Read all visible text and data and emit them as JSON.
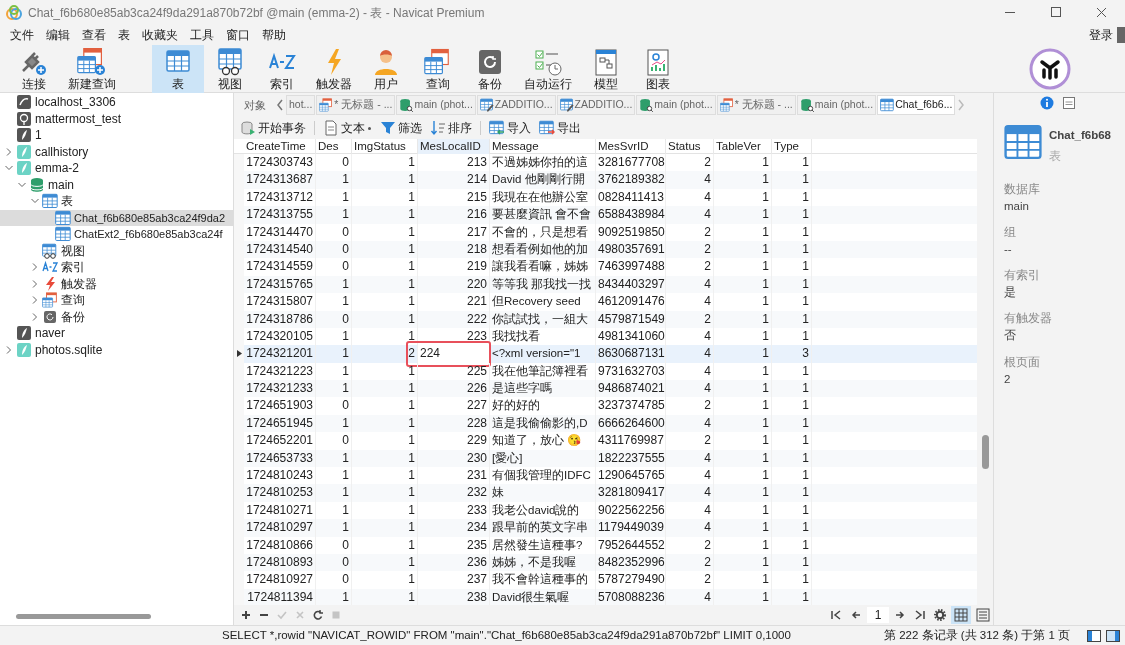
{
  "window": {
    "title": "Chat_f6b680e85ab3ca24f9da291a870b72bf @main (emma-2) - 表 - Navicat Premium"
  },
  "menu": [
    "文件",
    "编辑",
    "查看",
    "表",
    "收藏夹",
    "工具",
    "窗口",
    "帮助"
  ],
  "login": "登录",
  "toolbar": [
    {
      "label": "连接",
      "selected": false
    },
    {
      "label": "新建查询",
      "selected": false
    },
    {
      "label": "表",
      "selected": true
    },
    {
      "label": "视图",
      "selected": false
    },
    {
      "label": "索引",
      "selected": false
    },
    {
      "label": "触发器",
      "selected": false
    },
    {
      "label": "用户",
      "selected": false
    },
    {
      "label": "查询",
      "selected": false
    },
    {
      "label": "备份",
      "selected": false
    },
    {
      "label": "自动运行",
      "selected": false
    },
    {
      "label": "模型",
      "selected": false
    },
    {
      "label": "图表",
      "selected": false
    }
  ],
  "sidebar": {
    "tree": [
      {
        "kind": "mysql",
        "label": "localhost_3306",
        "selected": false
      },
      {
        "kind": "postgres",
        "label": "mattermost_test",
        "selected": false
      },
      {
        "kind": "sqlite-off",
        "label": "1",
        "selected": false
      },
      {
        "kind": "sqlite",
        "label": "callhistory",
        "expanded": false,
        "selected": false
      },
      {
        "kind": "sqlite",
        "label": "emma-2",
        "expanded": true,
        "selected": false,
        "children": [
          {
            "kind": "database",
            "label": "main",
            "expanded": true,
            "selected": false,
            "children": [
              {
                "kind": "tables",
                "label": "表",
                "expanded": true,
                "selected": false,
                "children": [
                  {
                    "kind": "table",
                    "label": "Chat_f6b680e85ab3ca24f9da2",
                    "selected": true
                  },
                  {
                    "kind": "table",
                    "label": "ChatExt2_f6b680e85ab3ca24f",
                    "selected": false
                  }
                ]
              },
              {
                "kind": "view",
                "label": "视图",
                "selected": false
              },
              {
                "kind": "index",
                "label": "索引",
                "expanded": false,
                "selected": false
              },
              {
                "kind": "trigger",
                "label": "触发器",
                "expanded": false,
                "selected": false
              },
              {
                "kind": "query",
                "label": "查询",
                "expanded": false,
                "selected": false
              },
              {
                "kind": "backup",
                "label": "备份",
                "expanded": false,
                "selected": false
              }
            ]
          }
        ]
      },
      {
        "kind": "sqlite-off",
        "label": "naver",
        "selected": false
      },
      {
        "kind": "sqlite",
        "label": "photos.sqlite",
        "expanded": false,
        "selected": false
      }
    ]
  },
  "tabs": {
    "objects_label": "对象",
    "items": [
      {
        "kind": "plain",
        "label": "hot...",
        "selected": false
      },
      {
        "kind": "query",
        "label": "* 无标题 - ...",
        "selected": false
      },
      {
        "kind": "database",
        "label": "main (phot...",
        "selected": false
      },
      {
        "kind": "design",
        "label": "ZADDITIO...",
        "selected": false
      },
      {
        "kind": "design",
        "label": "ZADDITIO...",
        "selected": false
      },
      {
        "kind": "database",
        "label": "main (phot...",
        "selected": false
      },
      {
        "kind": "query",
        "label": "* 无标题 - ...",
        "selected": false
      },
      {
        "kind": "database",
        "label": "main (phot...",
        "selected": false
      },
      {
        "kind": "table",
        "label": "Chat_f6b6...",
        "selected": true
      }
    ]
  },
  "actions": [
    "开始事务",
    "文本",
    "筛选",
    "排序",
    "导入",
    "导出"
  ],
  "table": {
    "columns": [
      "CreateTime",
      "Des",
      "ImgStatus",
      "MesLocalID",
      "Message",
      "MesSvrID",
      "Status",
      "TableVer",
      "Type"
    ],
    "rows": [
      {
        "cells": [
          "1724303743",
          "0",
          "1",
          "213",
          "不過姊姊你拍的這",
          "3281677708",
          "2",
          "1",
          "1"
        ],
        "current": false,
        "editing": false,
        "highlighted": false
      },
      {
        "cells": [
          "1724313687",
          "1",
          "1",
          "214",
          "David 他剛剛行開",
          "3762189382",
          "4",
          "1",
          "1"
        ],
        "current": false,
        "editing": false,
        "highlighted": false
      },
      {
        "cells": [
          "1724313712",
          "1",
          "1",
          "215",
          "我現在在他辦公室",
          "0828411413",
          "4",
          "1",
          "1"
        ],
        "current": false,
        "editing": false,
        "highlighted": false
      },
      {
        "cells": [
          "1724313755",
          "1",
          "1",
          "216",
          "要甚麼資訊 會不會",
          "6588438984",
          "4",
          "1",
          "1"
        ],
        "current": false,
        "editing": false,
        "highlighted": false
      },
      {
        "cells": [
          "1724314470",
          "0",
          "1",
          "217",
          "不會的，只是想看",
          "9092519850",
          "2",
          "1",
          "1"
        ],
        "current": false,
        "editing": false,
        "highlighted": false
      },
      {
        "cells": [
          "1724314540",
          "0",
          "1",
          "218",
          "想看看例如他的加",
          "4980357691",
          "2",
          "1",
          "1"
        ],
        "current": false,
        "editing": false,
        "highlighted": false
      },
      {
        "cells": [
          "1724314559",
          "0",
          "1",
          "219",
          "讓我看看嘛，姊姊",
          "7463997488",
          "2",
          "1",
          "1"
        ],
        "current": false,
        "editing": false,
        "highlighted": false
      },
      {
        "cells": [
          "1724315765",
          "1",
          "1",
          "220",
          "等等我 那我找一找",
          "8434403297",
          "4",
          "1",
          "1"
        ],
        "current": false,
        "editing": false,
        "highlighted": false
      },
      {
        "cells": [
          "1724315807",
          "1",
          "1",
          "221",
          "但Recovery seed",
          "4612091476",
          "4",
          "1",
          "1"
        ],
        "current": false,
        "editing": false,
        "highlighted": false
      },
      {
        "cells": [
          "1724318786",
          "0",
          "1",
          "222",
          "你試試找，一組大",
          "4579871549",
          "2",
          "1",
          "1"
        ],
        "current": false,
        "editing": false,
        "highlighted": false
      },
      {
        "cells": [
          "1724320105",
          "1",
          "1",
          "223",
          "我找找看",
          "4981341060",
          "4",
          "1",
          "1"
        ],
        "current": false,
        "editing": false,
        "highlighted": false
      },
      {
        "cells": [
          "1724321201",
          "1",
          "2",
          "224",
          "<?xml version=\"1",
          "8630687131",
          "4",
          "1",
          "3"
        ],
        "current": true,
        "editing": true,
        "highlighted": true
      },
      {
        "cells": [
          "1724321223",
          "1",
          "1",
          "225",
          "我在他筆記簿裡看",
          "9731632703",
          "4",
          "1",
          "1"
        ],
        "current": false,
        "editing": false,
        "highlighted": false
      },
      {
        "cells": [
          "1724321233",
          "1",
          "1",
          "226",
          "是這些字嗎",
          "9486874021",
          "4",
          "1",
          "1"
        ],
        "current": false,
        "editing": false,
        "highlighted": false
      },
      {
        "cells": [
          "1724651903",
          "0",
          "1",
          "227",
          "好的好的",
          "3237374785",
          "2",
          "1",
          "1"
        ],
        "current": false,
        "editing": false,
        "highlighted": false
      },
      {
        "cells": [
          "1724651945",
          "1",
          "1",
          "228",
          "這是我偷偷影的,D",
          "6666264600",
          "4",
          "1",
          "1"
        ],
        "current": false,
        "editing": false,
        "highlighted": false
      },
      {
        "cells": [
          "1724652201",
          "0",
          "1",
          "229",
          "知道了，放心 😘",
          "4311769987",
          "2",
          "1",
          "1"
        ],
        "current": false,
        "editing": false,
        "highlighted": false
      },
      {
        "cells": [
          "1724653733",
          "1",
          "1",
          "230",
          "[愛心]",
          "1822237555",
          "4",
          "1",
          "1"
        ],
        "current": false,
        "editing": false,
        "highlighted": false
      },
      {
        "cells": [
          "1724810243",
          "1",
          "1",
          "231",
          "有個我管理的IDFC",
          "1290645765",
          "4",
          "1",
          "1"
        ],
        "current": false,
        "editing": false,
        "highlighted": false
      },
      {
        "cells": [
          "1724810253",
          "1",
          "1",
          "232",
          "妹",
          "3281809417",
          "4",
          "1",
          "1"
        ],
        "current": false,
        "editing": false,
        "highlighted": false
      },
      {
        "cells": [
          "1724810271",
          "1",
          "1",
          "233",
          "我老公david說的",
          "9022562256",
          "4",
          "1",
          "1"
        ],
        "current": false,
        "editing": false,
        "highlighted": false
      },
      {
        "cells": [
          "1724810297",
          "1",
          "1",
          "234",
          "跟早前的英文字串",
          "1179449039",
          "4",
          "1",
          "1"
        ],
        "current": false,
        "editing": false,
        "highlighted": false
      },
      {
        "cells": [
          "1724810866",
          "0",
          "1",
          "235",
          "居然發生這種事?",
          "7952644552",
          "2",
          "1",
          "1"
        ],
        "current": false,
        "editing": false,
        "highlighted": false
      },
      {
        "cells": [
          "1724810893",
          "0",
          "1",
          "236",
          "姊姊，不是我喔",
          "8482352996",
          "2",
          "1",
          "1"
        ],
        "current": false,
        "editing": false,
        "highlighted": false
      },
      {
        "cells": [
          "1724810927",
          "0",
          "1",
          "237",
          "我不會幹這種事的",
          "5787279490",
          "2",
          "1",
          "1"
        ],
        "current": false,
        "editing": false,
        "highlighted": false
      },
      {
        "cells": [
          "1724811394",
          "1",
          "1",
          "238",
          "David很生氣喔",
          "5708088236",
          "4",
          "1",
          "1"
        ],
        "current": false,
        "editing": false,
        "highlighted": false
      }
    ]
  },
  "edit_buttons": [
    {
      "disabled": false
    },
    {
      "disabled": false
    },
    {
      "disabled": true
    },
    {
      "disabled": true
    },
    {
      "disabled": false
    },
    {
      "disabled": true
    }
  ],
  "pager": {
    "page": "1",
    "view_modes": [
      {
        "selected": true
      },
      {
        "selected": false
      }
    ]
  },
  "info": {
    "panel_tabs": [
      {
        "selected": true
      },
      {
        "selected": false
      }
    ],
    "name": "Chat_f6b68",
    "type": "表",
    "fields": [
      {
        "label": "数据库",
        "value": "main"
      },
      {
        "label": "组",
        "value": "--"
      },
      {
        "label": "有索引",
        "value": "是"
      },
      {
        "label": "有触发器",
        "value": "否"
      },
      {
        "label": "根页面",
        "value": "2"
      }
    ]
  },
  "status_bar": {
    "sql": "SELECT *,rowid \"NAVICAT_ROWID\" FROM \"main\".\"Chat_f6b680e85ab3ca24f9da291a870b72bf\" LIMIT 0,1000",
    "record": "第 222 条记录 (共 312 条) 于第 1 页"
  }
}
